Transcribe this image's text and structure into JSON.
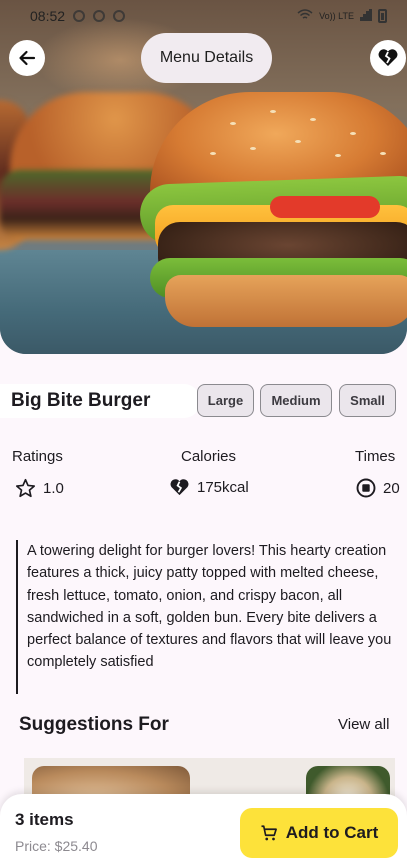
{
  "status_bar": {
    "time": "08:52",
    "network_label": "Vo)) LTE"
  },
  "header": {
    "title": "Menu Details"
  },
  "product": {
    "name": "Big Bite Burger",
    "sizes": [
      "Large",
      "Medium",
      "Small"
    ]
  },
  "stats": {
    "ratings": {
      "label": "Ratings",
      "value": "1.0"
    },
    "calories": {
      "label": "Calories",
      "value": "175kcal"
    },
    "times": {
      "label": "Times",
      "value": "20"
    }
  },
  "description": "A towering delight for burger lovers! This hearty creation features a thick, juicy patty topped with melted cheese, fresh lettuce, tomato, onion, and crispy bacon, all sandwiched in a soft, golden bun. Every bite delivers a perfect balance of textures and flavors that will leave you completely satisfied",
  "suggestions": {
    "title": "Suggestions For",
    "view_all": "View all"
  },
  "cart": {
    "items_count": "3 items",
    "price": "Price: $25.40",
    "add_label": "Add to Cart"
  },
  "colors": {
    "accent": "#fde23a",
    "background": "#fdf7fc"
  }
}
